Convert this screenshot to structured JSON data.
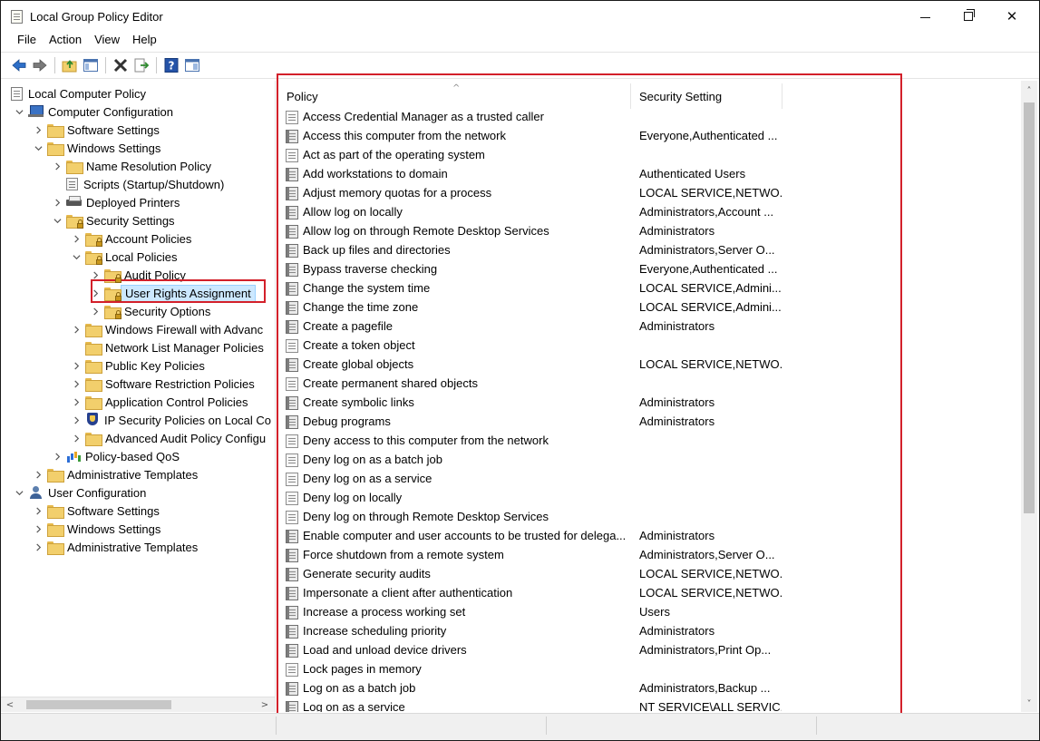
{
  "window": {
    "title": "Local Group Policy Editor"
  },
  "menu": [
    "File",
    "Action",
    "View",
    "Help"
  ],
  "toolbar": [
    "back-icon",
    "forward-icon",
    "up-folder-icon",
    "show-hide-tree-icon",
    "delete-icon",
    "export-list-icon",
    "help-icon",
    "properties-pane-icon"
  ],
  "tree": [
    {
      "label": "Local Computer Policy",
      "icon": "doc",
      "indent": 0,
      "chevron": ""
    },
    {
      "label": "Computer Configuration",
      "icon": "pc",
      "indent": 0,
      "chevron": "down"
    },
    {
      "label": "Software Settings",
      "icon": "folder",
      "indent": 1,
      "chevron": "right"
    },
    {
      "label": "Windows Settings",
      "icon": "folder",
      "indent": 1,
      "chevron": "down"
    },
    {
      "label": "Name Resolution Policy",
      "icon": "folder",
      "indent": 2,
      "chevron": "right"
    },
    {
      "label": "Scripts (Startup/Shutdown)",
      "icon": "script",
      "indent": 2,
      "chevron": ""
    },
    {
      "label": "Deployed Printers",
      "icon": "printer",
      "indent": 2,
      "chevron": "right"
    },
    {
      "label": "Security Settings",
      "icon": "folder-lock",
      "indent": 2,
      "chevron": "down"
    },
    {
      "label": "Account Policies",
      "icon": "folder-lock",
      "indent": 3,
      "chevron": "right"
    },
    {
      "label": "Local Policies",
      "icon": "folder-lock",
      "indent": 3,
      "chevron": "down"
    },
    {
      "label": "Audit Policy",
      "icon": "folder-lock",
      "indent": 4,
      "chevron": "right"
    },
    {
      "label": "User Rights Assignment",
      "icon": "folder-lock",
      "indent": 4,
      "chevron": "right",
      "selected": true
    },
    {
      "label": "Security Options",
      "icon": "folder-lock",
      "indent": 4,
      "chevron": "right"
    },
    {
      "label": "Windows Firewall with Advanc",
      "icon": "folder",
      "indent": 3,
      "chevron": "right"
    },
    {
      "label": "Network List Manager Policies",
      "icon": "folder",
      "indent": 3,
      "chevron": ""
    },
    {
      "label": "Public Key Policies",
      "icon": "folder",
      "indent": 3,
      "chevron": "right"
    },
    {
      "label": "Software Restriction Policies",
      "icon": "folder",
      "indent": 3,
      "chevron": "right"
    },
    {
      "label": "Application Control Policies",
      "icon": "folder",
      "indent": 3,
      "chevron": "right"
    },
    {
      "label": "IP Security Policies on Local Co",
      "icon": "shield",
      "indent": 3,
      "chevron": "right"
    },
    {
      "label": "Advanced Audit Policy Configu",
      "icon": "folder",
      "indent": 3,
      "chevron": "right"
    },
    {
      "label": "Policy-based QoS",
      "icon": "qos",
      "indent": 2,
      "chevron": "right"
    },
    {
      "label": "Administrative Templates",
      "icon": "folder",
      "indent": 1,
      "chevron": "right"
    },
    {
      "label": "User Configuration",
      "icon": "user",
      "indent": 0,
      "chevron": "down"
    },
    {
      "label": "Software Settings",
      "icon": "folder",
      "indent": 1,
      "chevron": "right"
    },
    {
      "label": "Windows Settings",
      "icon": "folder",
      "indent": 1,
      "chevron": "right"
    },
    {
      "label": "Administrative Templates",
      "icon": "folder",
      "indent": 1,
      "chevron": "right"
    }
  ],
  "list": {
    "columns": [
      "Policy",
      "Security Setting"
    ],
    "rows": [
      {
        "policy": "Access Credential Manager as a trusted caller",
        "setting": ""
      },
      {
        "policy": "Access this computer from the network",
        "setting": "Everyone,Authenticated ..."
      },
      {
        "policy": "Act as part of the operating system",
        "setting": ""
      },
      {
        "policy": "Add workstations to domain",
        "setting": "Authenticated Users"
      },
      {
        "policy": "Adjust memory quotas for a process",
        "setting": "LOCAL SERVICE,NETWO..."
      },
      {
        "policy": "Allow log on locally",
        "setting": "Administrators,Account ..."
      },
      {
        "policy": "Allow log on through Remote Desktop Services",
        "setting": "Administrators"
      },
      {
        "policy": "Back up files and directories",
        "setting": "Administrators,Server O..."
      },
      {
        "policy": "Bypass traverse checking",
        "setting": "Everyone,Authenticated ..."
      },
      {
        "policy": "Change the system time",
        "setting": "LOCAL SERVICE,Admini..."
      },
      {
        "policy": "Change the time zone",
        "setting": "LOCAL SERVICE,Admini..."
      },
      {
        "policy": "Create a pagefile",
        "setting": "Administrators"
      },
      {
        "policy": "Create a token object",
        "setting": ""
      },
      {
        "policy": "Create global objects",
        "setting": "LOCAL SERVICE,NETWO..."
      },
      {
        "policy": "Create permanent shared objects",
        "setting": ""
      },
      {
        "policy": "Create symbolic links",
        "setting": "Administrators"
      },
      {
        "policy": "Debug programs",
        "setting": "Administrators"
      },
      {
        "policy": "Deny access to this computer from the network",
        "setting": ""
      },
      {
        "policy": "Deny log on as a batch job",
        "setting": ""
      },
      {
        "policy": "Deny log on as a service",
        "setting": ""
      },
      {
        "policy": "Deny log on locally",
        "setting": ""
      },
      {
        "policy": "Deny log on through Remote Desktop Services",
        "setting": ""
      },
      {
        "policy": "Enable computer and user accounts to be trusted for delega...",
        "setting": "Administrators"
      },
      {
        "policy": "Force shutdown from a remote system",
        "setting": "Administrators,Server O..."
      },
      {
        "policy": "Generate security audits",
        "setting": "LOCAL SERVICE,NETWO..."
      },
      {
        "policy": "Impersonate a client after authentication",
        "setting": "LOCAL SERVICE,NETWO..."
      },
      {
        "policy": "Increase a process working set",
        "setting": "Users"
      },
      {
        "policy": "Increase scheduling priority",
        "setting": "Administrators"
      },
      {
        "policy": "Load and unload device drivers",
        "setting": "Administrators,Print Op..."
      },
      {
        "policy": "Lock pages in memory",
        "setting": ""
      },
      {
        "policy": "Log on as a batch job",
        "setting": "Administrators,Backup ..."
      },
      {
        "policy": "Log on as a service",
        "setting": "NT SERVICE\\ALL SERVIC..."
      }
    ]
  },
  "colors": {
    "highlight_border": "#d3202a",
    "selection": "#cce8ff"
  }
}
